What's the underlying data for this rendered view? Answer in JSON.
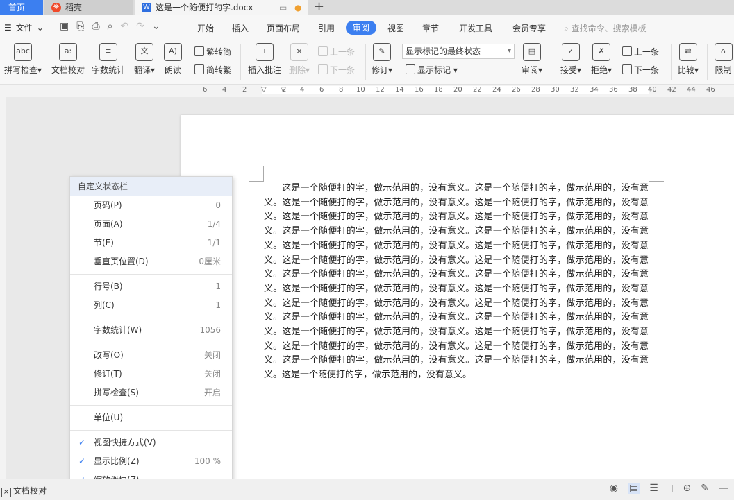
{
  "tabs": {
    "home": "首页",
    "daoke": "稻壳",
    "document": "这是一个随便打的字.docx"
  },
  "menu": {
    "file": "文件",
    "items": [
      "开始",
      "插入",
      "页面布局",
      "引用",
      "审阅",
      "视图",
      "章节",
      "开发工具",
      "会员专享"
    ],
    "active": "审阅",
    "search": "查找命令、搜索模板"
  },
  "ribbon": {
    "spell": "拼写检查",
    "doc_proof": "文档校对",
    "word_count": "字数统计",
    "translate": "翻译",
    "read_aloud": "朗读",
    "to_traditional": "繁转简",
    "to_simplified": "简转繁",
    "insert_comment": "插入批注",
    "delete": "删除",
    "prev_comment": "上一条",
    "next_comment": "下一条",
    "track": "修订",
    "status_select": "显示标记的最终状态",
    "show_markup": "显示标记",
    "review": "审阅",
    "accept": "接受",
    "reject": "拒绝",
    "prev_change": "上一条",
    "next_change": "下一条",
    "compare": "比较",
    "restrict": "限制"
  },
  "ruler_ticks": [
    "6",
    "4",
    "2",
    "",
    "2",
    "4",
    "6",
    "8",
    "10",
    "12",
    "14",
    "16",
    "18",
    "20",
    "22",
    "24",
    "26",
    "28",
    "30",
    "32",
    "34",
    "36",
    "38",
    "40",
    "42",
    "44",
    "46"
  ],
  "document": {
    "text": "这是一个随便打的字，做示范用的，没有意义。这是一个随便打的字，做示范用的，没有意义。这是一个随便打的字，做示范用的，没有意义。这是一个随便打的字，做示范用的，没有意义。这是一个随便打的字，做示范用的，没有意义。这是一个随便打的字，做示范用的，没有意义。这是一个随便打的字，做示范用的，没有意义。这是一个随便打的字，做示范用的，没有意义。这是一个随便打的字，做示范用的，没有意义。这是一个随便打的字，做示范用的，没有意义。这是一个随便打的字，做示范用的，没有意义。这是一个随便打的字，做示范用的，没有意义。这是一个随便打的字，做示范用的，没有意义。这是一个随便打的字，做示范用的，没有意义。这是一个随便打的字，做示范用的，没有意义。这是一个随便打的字，做示范用的，没有意义。这是一个随便打的字，做示范用的，没有意义。这是一个随便打的字，做示范用的，没有意义。这是一个随便打的字，做示范用的，没有意义。这是一个随便打的字，做示范用的，没有意义。这是一个随便打的字，做示范用的，没有意义。这是一个随便打的字，做示范用的，没有意义。这是一个随便打的字，做示范用的，没有意义。这是一个随便打的字，做示范用的，没有意义。这是一个随便打的字，做示范用的，没有意义。这是一个随便打的字，做示范用的，没有意义。这是一个随便打的字，做示范用的，没有意义。"
  },
  "popup": {
    "title": "自定义状态栏",
    "groups": [
      [
        {
          "label": "页码(P)",
          "value": "0"
        },
        {
          "label": "页面(A)",
          "value": "1/4"
        },
        {
          "label": "节(E)",
          "value": "1/1"
        },
        {
          "label": "垂直页位置(D)",
          "value": "0厘米"
        }
      ],
      [
        {
          "label": "行号(B)",
          "value": "1"
        },
        {
          "label": "列(C)",
          "value": "1"
        }
      ],
      [
        {
          "label": "字数统计(W)",
          "value": "1056"
        }
      ],
      [
        {
          "label": "改写(O)",
          "value": "关闭"
        },
        {
          "label": "修订(T)",
          "value": "关闭"
        },
        {
          "label": "拼写检查(S)",
          "value": "开启"
        }
      ],
      [
        {
          "label": "单位(U)",
          "value": ""
        }
      ],
      [
        {
          "label": "视图快捷方式(V)",
          "value": "",
          "checked": true
        },
        {
          "label": "显示比例(Z)",
          "value": "100 %",
          "checked": true
        },
        {
          "label": "缩放滑块(Z)",
          "value": "",
          "checked": true
        }
      ]
    ]
  },
  "statusbar": {
    "doc_proof": "文档校对"
  }
}
